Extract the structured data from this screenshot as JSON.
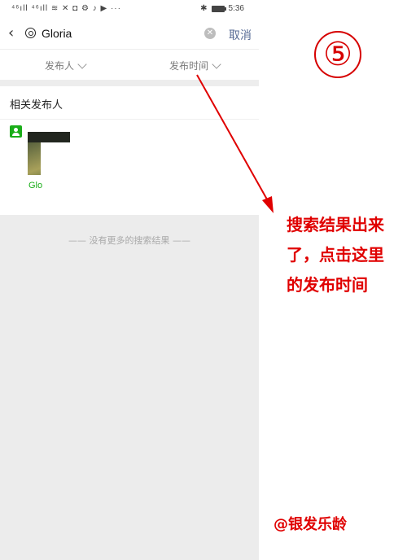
{
  "status_bar": {
    "left": "⁴⁶ıll ⁴⁶ıll ≋ ✕ ◘ ⚙ ♪ ▶ ···",
    "right_bt": "✱",
    "time": "5:36"
  },
  "search": {
    "query": "Gloria",
    "cancel_label": "取消"
  },
  "filters": {
    "publisher": "发布人",
    "publish_time": "发布时间"
  },
  "results": {
    "section_title": "相关发布人",
    "publisher_name": "Glo",
    "end_text": "—— 没有更多的搜索结果 ——"
  },
  "annotation": {
    "step": "⑤",
    "line1": "搜索结果出来",
    "line2": "了，点击这里",
    "line3": "的发布时间",
    "watermark": "@银发乐龄"
  },
  "colors": {
    "accent_link": "#576b95",
    "wechat_green": "#1aad19",
    "annotation_red": "#e00000"
  }
}
